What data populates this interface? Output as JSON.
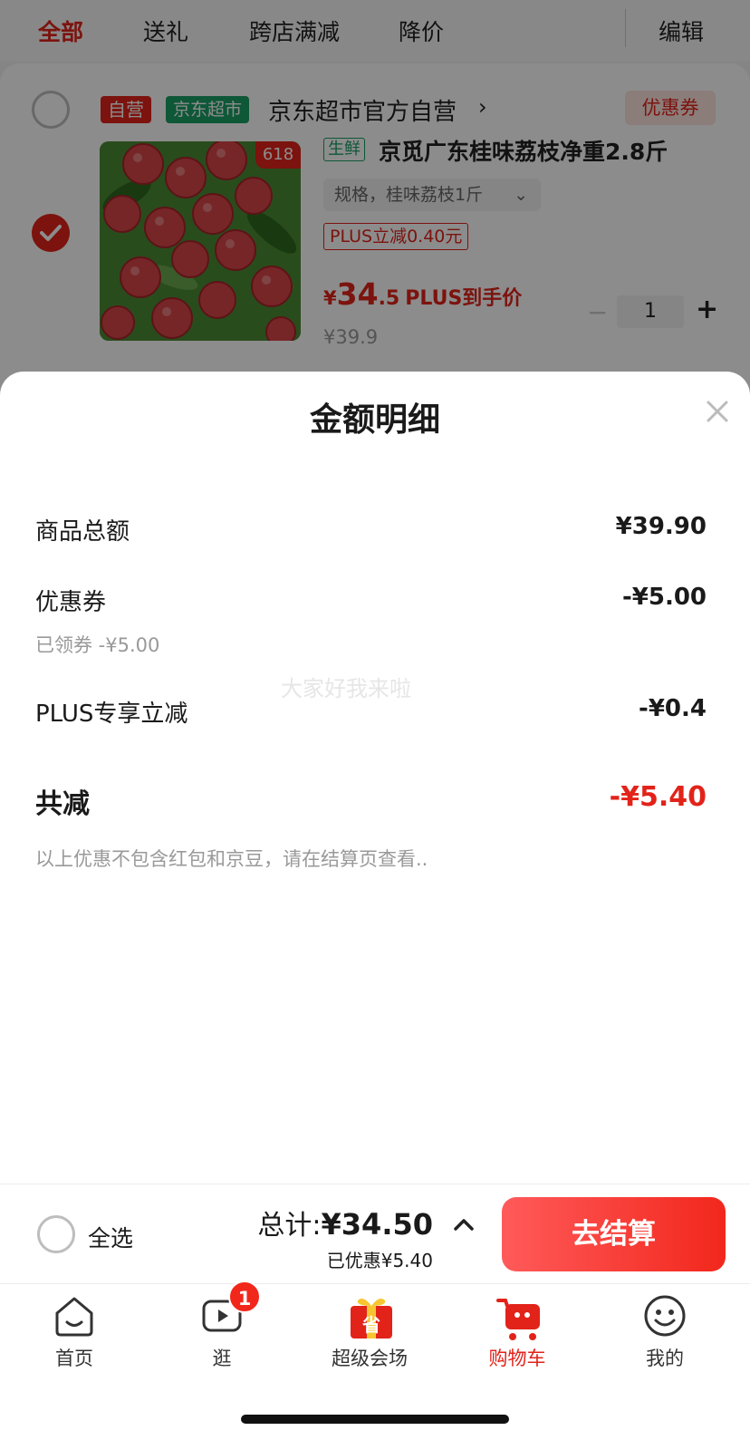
{
  "filter_tabs": [
    "全部",
    "送礼",
    "跨店满减",
    "降价"
  ],
  "edit_label": "编辑",
  "shop": {
    "ziying_tag": "自营",
    "market_tag": "京东超市",
    "name": "京东超市官方自营",
    "coupon_button": "优惠券"
  },
  "product": {
    "badge": "618",
    "fresh_tag": "生鲜",
    "title": "京觅广东桂味荔枝净重2.8斤",
    "spec": "规格，桂味荔枝1斤",
    "plus_tag": "PLUS立减0.40元",
    "price_symbol": "¥",
    "price_int": "34",
    "price_dec": ".5",
    "price_note": "PLUS到手价",
    "original_price": "¥39.9",
    "quantity": "1"
  },
  "sheet": {
    "title": "金额明细",
    "rows": [
      {
        "label": "商品总额",
        "value": "¥39.90"
      },
      {
        "label": "优惠券",
        "value": "-¥5.00",
        "sub": "已领券 -¥5.00"
      },
      {
        "label": "PLUS专享立减",
        "value": "-¥0.4"
      }
    ],
    "watermark": "大家好我来啦",
    "total_label": "共减",
    "total_value": "-¥5.40",
    "note": "以上优惠不包含红包和京豆，请在结算页查看.."
  },
  "checkout": {
    "select_all": "全选",
    "total_prefix": "总计:",
    "total_amount": "¥34.50",
    "saved": "已优惠¥5.40",
    "pay_button": "去结算"
  },
  "tabs": [
    {
      "label": "首页",
      "icon": "home-icon"
    },
    {
      "label": "逛",
      "icon": "play-icon",
      "badge": "1"
    },
    {
      "label": "超级会场",
      "icon": "gift-save-icon"
    },
    {
      "label": "购物车",
      "icon": "cart-icon",
      "active": true
    },
    {
      "label": "我的",
      "icon": "smile-profile-icon"
    }
  ],
  "colors": {
    "accent": "#e2231a",
    "market_green": "#1b9e64"
  }
}
